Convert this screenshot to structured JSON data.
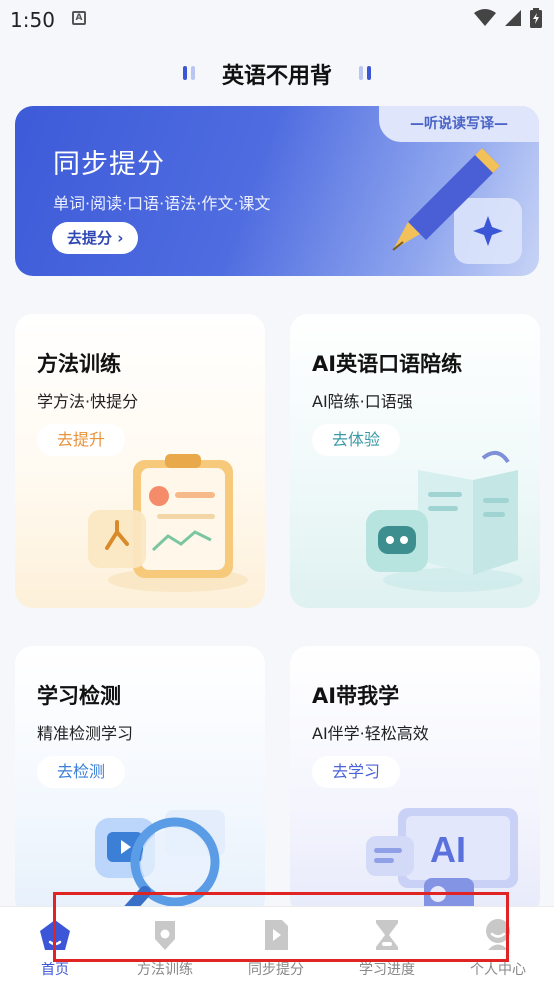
{
  "status_bar": {
    "time": "1:50",
    "notification_glyph": "A"
  },
  "header": {
    "title": "英语不用背"
  },
  "banner": {
    "tag": "—听说读写译—",
    "title": "同步提分",
    "subtitle": "单词·阅读·口语·语法·作文·课文",
    "button": "去提分 ›"
  },
  "cards": [
    {
      "title": "方法训练",
      "subtitle": "学方法·快提分",
      "button": "去提升",
      "color": "#e8923a"
    },
    {
      "title": "AI英语口语陪练",
      "subtitle": "AI陪练·口语强",
      "button": "去体验",
      "color": "#3a9aa6"
    },
    {
      "title": "学习检测",
      "subtitle": "精准检测学习",
      "button": "去检测",
      "color": "#3b7fd6"
    },
    {
      "title": "AI带我学",
      "subtitle": "AI伴学·轻松高效",
      "button": "去学习",
      "color": "#4c63d8"
    }
  ],
  "bottom_nav": [
    {
      "label": "首页",
      "icon": "home-icon",
      "active": true
    },
    {
      "label": "方法训练",
      "icon": "method-icon",
      "active": false
    },
    {
      "label": "同步提分",
      "icon": "sync-icon",
      "active": false
    },
    {
      "label": "学习进度",
      "icon": "hourglass-icon",
      "active": false
    },
    {
      "label": "个人中心",
      "icon": "profile-icon",
      "active": false
    }
  ],
  "colors": {
    "accent": "#3b56d6",
    "highlight": "#e02424"
  }
}
